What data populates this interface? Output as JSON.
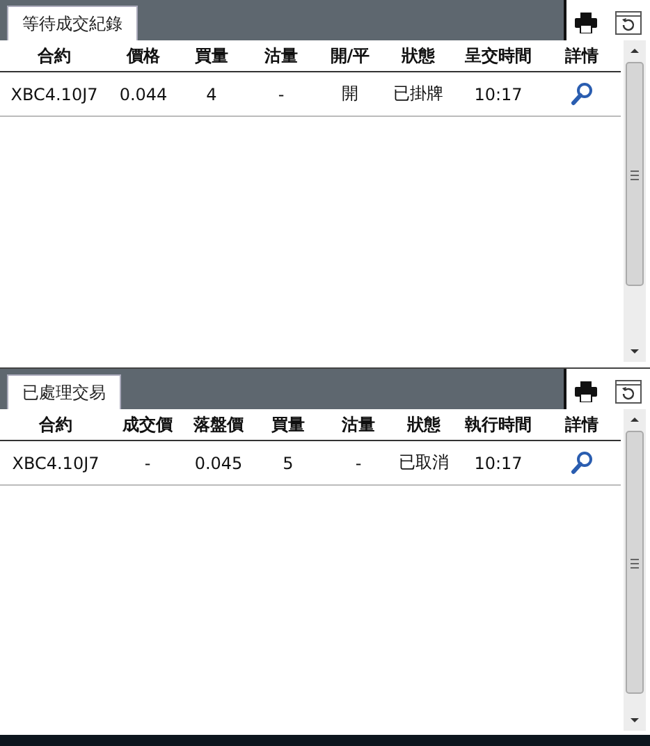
{
  "panels": [
    {
      "tab": {
        "label": "等待成交紀錄",
        "selected": true
      },
      "columns": [
        "合約",
        "價格",
        "買量",
        "沽量",
        "開/平",
        "狀態",
        "呈交時間",
        "詳情"
      ],
      "rows": [
        {
          "cells": [
            "XBC4.10J7",
            "0.044",
            "4",
            "-",
            "開",
            "已掛牌",
            "10:17"
          ]
        }
      ]
    },
    {
      "tab": {
        "label": "已處理交易",
        "selected": true
      },
      "columns": [
        "合約",
        "成交價",
        "落盤價",
        "買量",
        "沽量",
        "狀態",
        "執行時間",
        "詳情"
      ],
      "rows": [
        {
          "cells": [
            "XBC4.10J7",
            "-",
            "0.045",
            "5",
            "-",
            "已取消",
            "10:17"
          ]
        }
      ]
    }
  ]
}
